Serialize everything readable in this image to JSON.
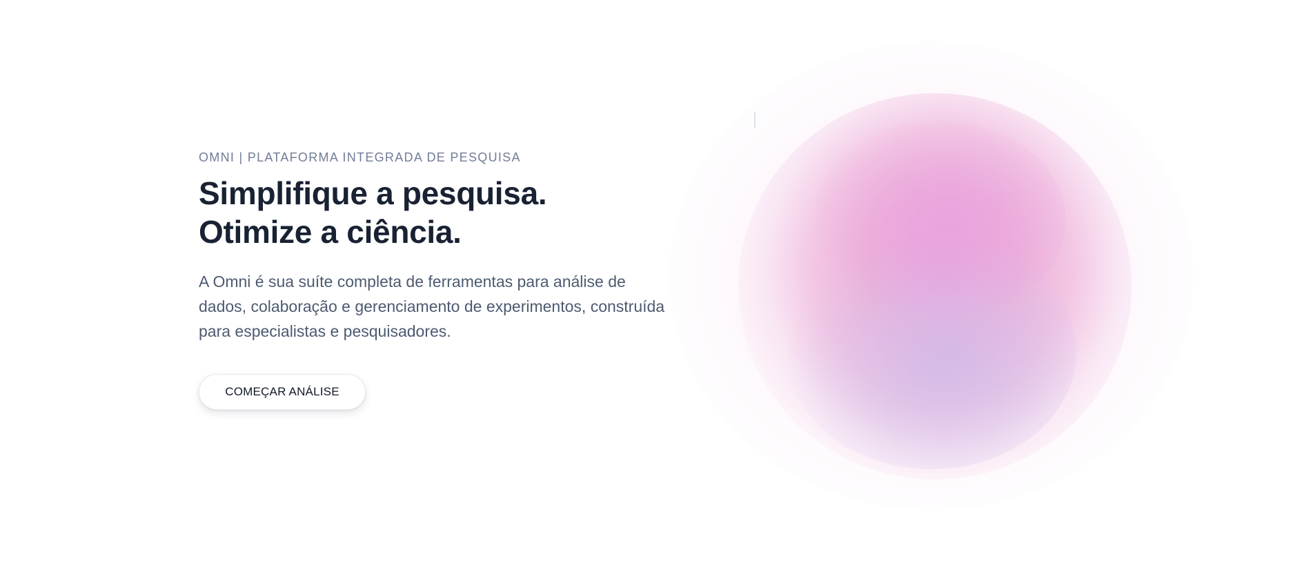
{
  "hero": {
    "eyebrow": "OMNI | PLATAFORMA INTEGRADA DE PESQUISA",
    "headline": {
      "line1": "Simplifique a pesquisa.",
      "line2": "Otimize a ciência."
    },
    "description": "A Omni é sua suíte completa de ferramentas para análise de dados, colaboração e gerenciamento de experimentos, construída para especialistas e pesquisadores.",
    "cta_label": "COMEÇAR ANÁLISE"
  },
  "colors": {
    "background": "#ffffff",
    "headline": "#192233",
    "eyebrow": "#717c96",
    "description": "#4d5a70",
    "glow_pink": "#eaa2d9",
    "glow_lavender": "#cbbcea"
  }
}
